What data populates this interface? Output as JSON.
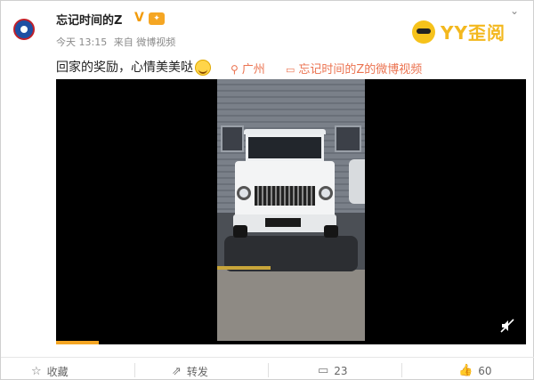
{
  "post": {
    "username": "忘记时间的Z",
    "verified_badge": "V",
    "meta": {
      "time": "今天 13:15",
      "source": "来自 微博视频"
    },
    "text": "回家的奖励，心情美美哒",
    "location": "广州",
    "video_source": "忘记时间的Z的微博视频"
  },
  "watermark": {
    "brand": "YY歪阅"
  },
  "video": {
    "progress": 0.09
  },
  "actions": {
    "favorite": "收藏",
    "repost": "转发",
    "comments": "23",
    "likes": "60"
  },
  "colors": {
    "accent_orange": "#eb7350",
    "progress": "#f5a623",
    "verified": "#f29b0a"
  },
  "icons": [
    "star-icon",
    "repost-icon",
    "comment-icon",
    "like-icon",
    "location-pin-icon",
    "video-icon",
    "mute-icon",
    "expand-icon"
  ]
}
